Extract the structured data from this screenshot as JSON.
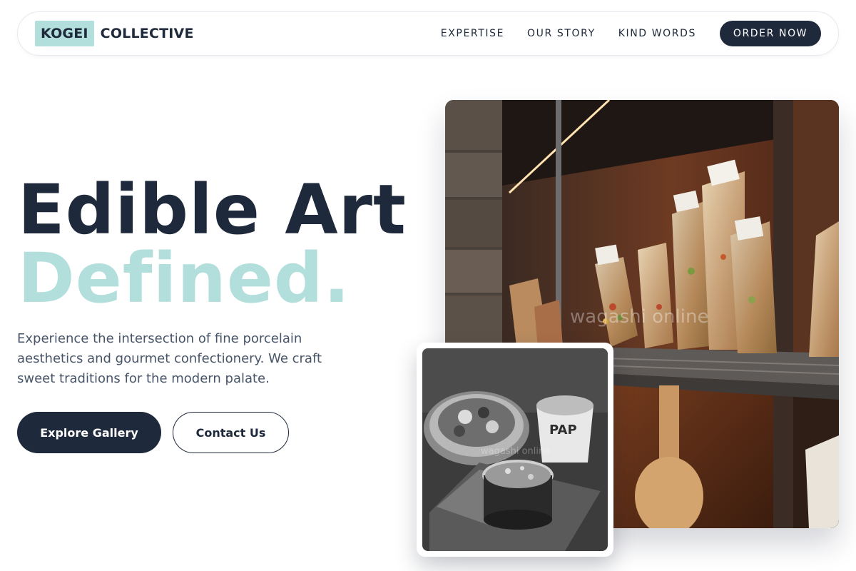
{
  "brand": {
    "mark": "KOGEI",
    "name": "COLLECTIVE",
    "accent_color": "#b2dfdb",
    "primary_color": "#1e293b"
  },
  "nav": {
    "links": [
      "EXPERTISE",
      "OUR STORY",
      "KIND WORDS"
    ],
    "cta": "ORDER NOW"
  },
  "hero": {
    "title_line1": "Edible Art",
    "title_line2": "Defined.",
    "description": "Experience the intersection of fine porcelain aesthetics and gourmet confectionery. We craft sweet traditions for the modern palate.",
    "primary_button": "Explore Gallery",
    "secondary_button": "Contact Us"
  },
  "images": {
    "main_watermark": "wagashi online",
    "small_watermark": "wagashi online"
  }
}
